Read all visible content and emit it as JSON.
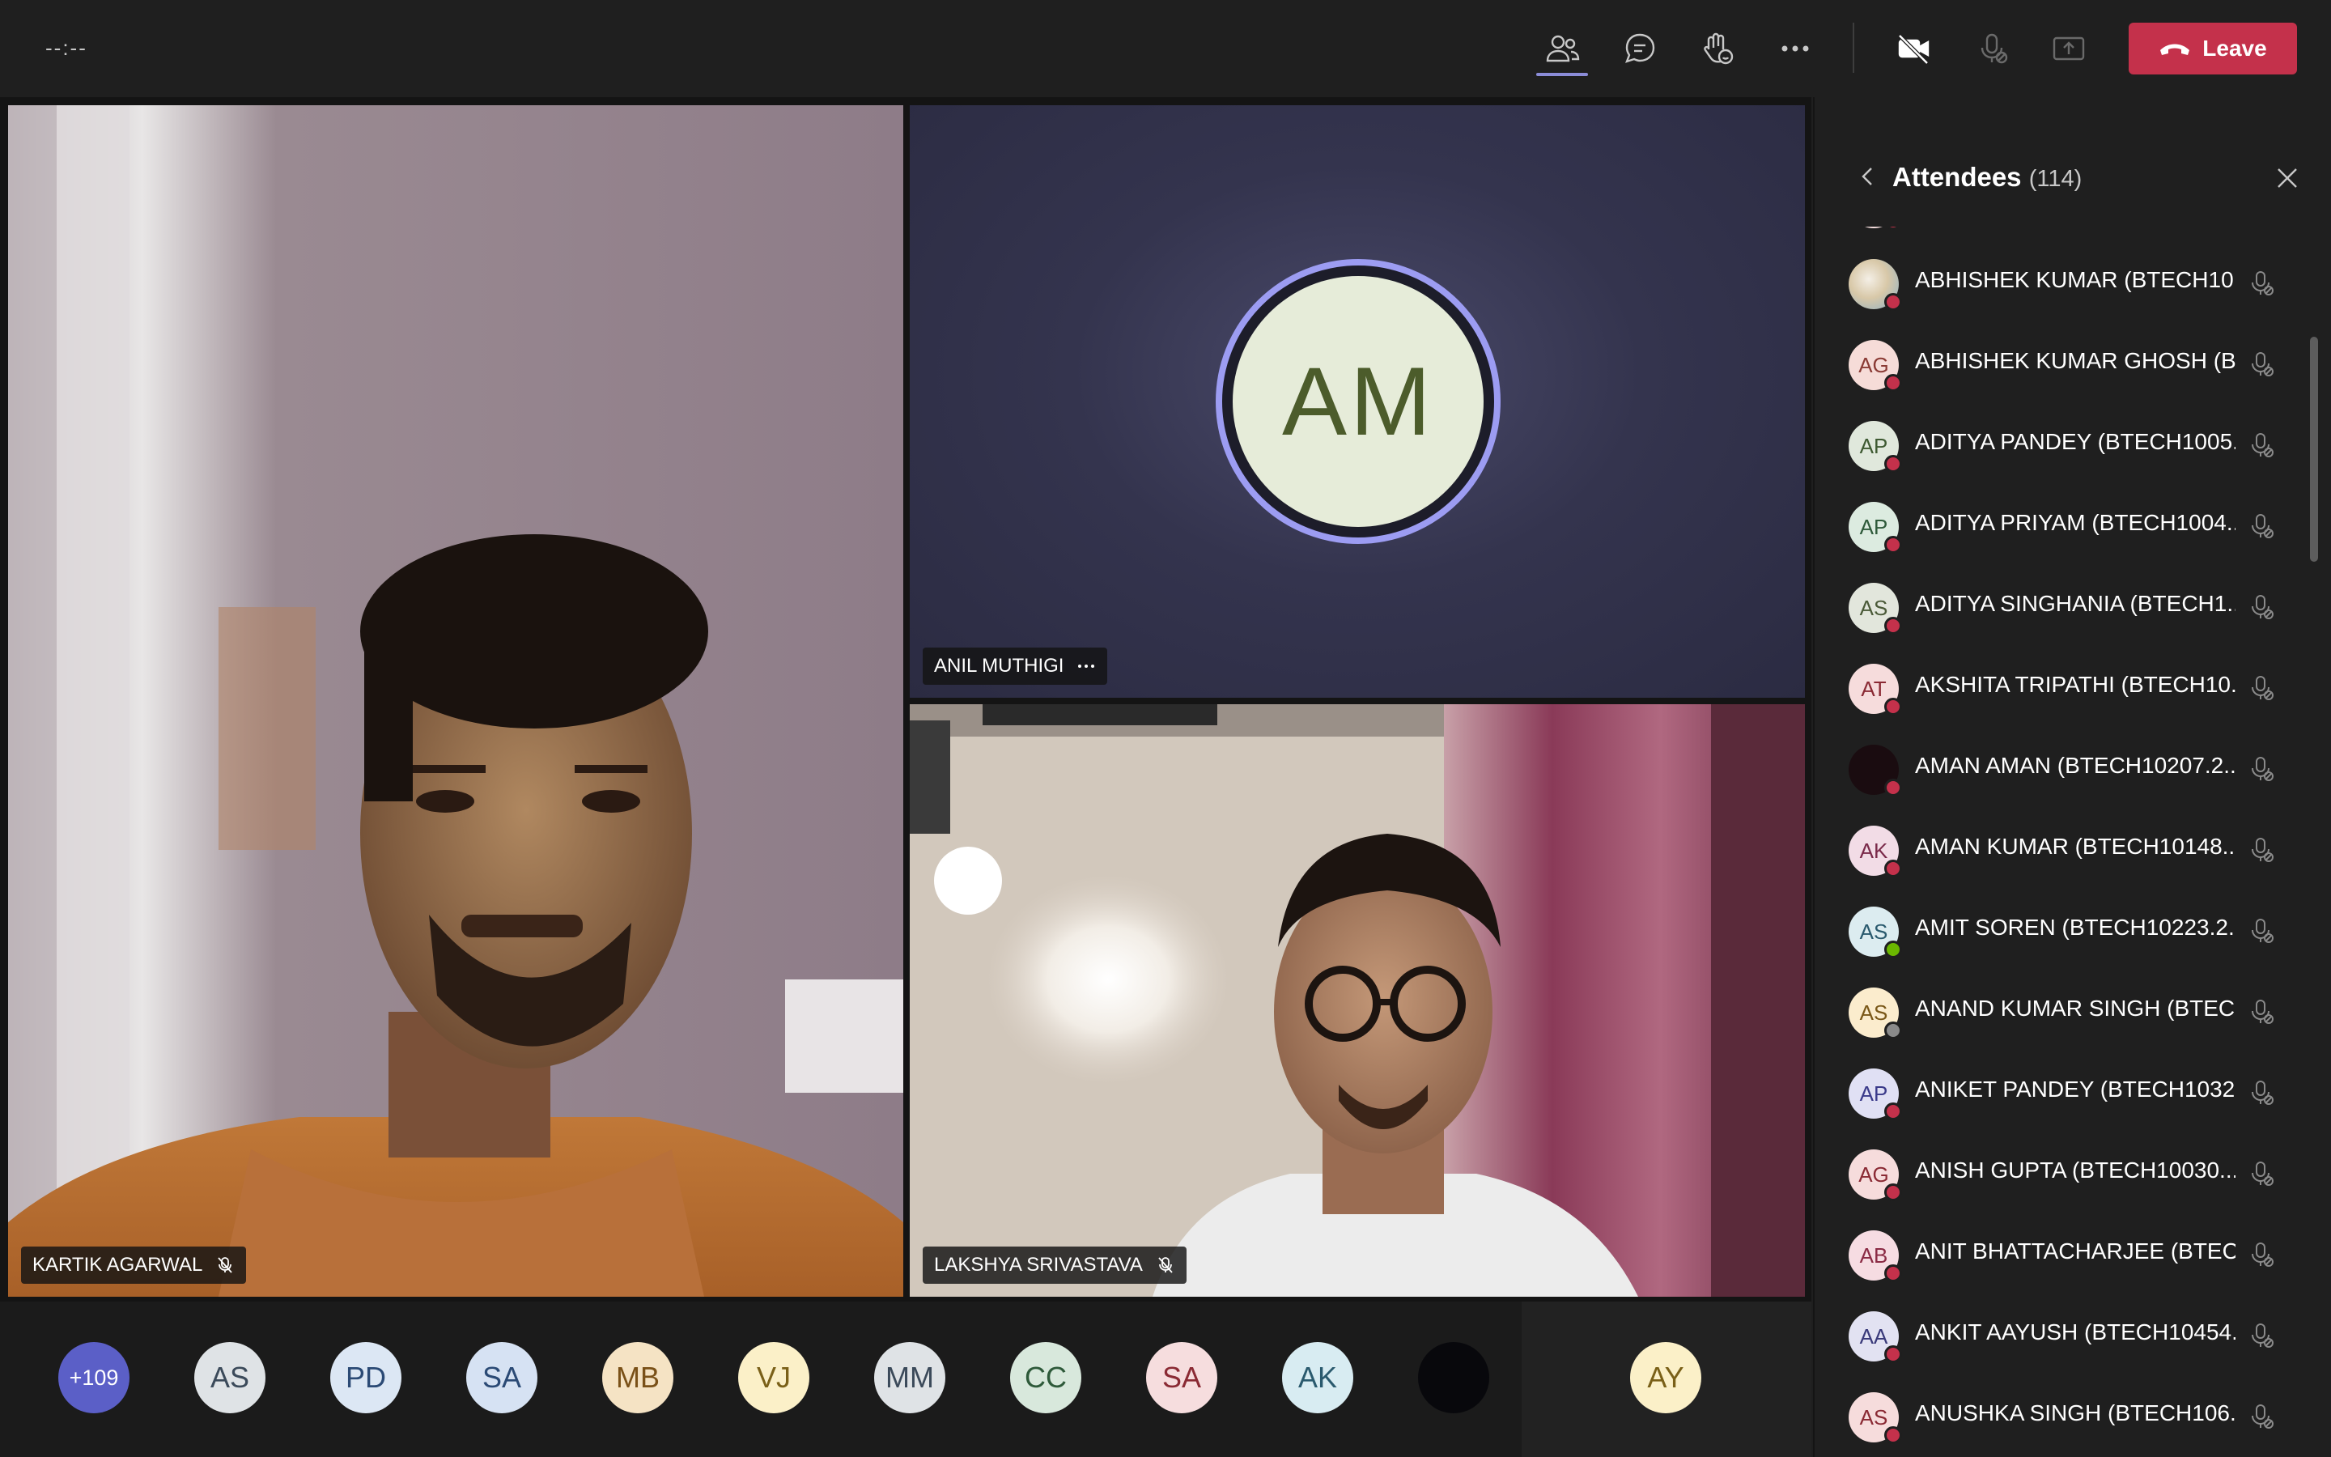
{
  "header": {
    "timer": "--:--",
    "leave_label": "Leave"
  },
  "toolbar": {
    "icons": [
      "people-icon",
      "chat-icon",
      "raise-hand-icon",
      "more-icon",
      "camera-off-icon",
      "mic-disabled-icon",
      "share-icon",
      "phone-hangup-icon"
    ]
  },
  "tiles": [
    {
      "name": "KARTIK AGARWAL",
      "muted": true
    },
    {
      "name": "ANIL MUTHIGI",
      "initials": "AM",
      "has_more": true
    },
    {
      "name": "LAKSHYA SRIVASTAVA",
      "muted": true
    }
  ],
  "strip": {
    "overflow_label": "+109",
    "avatars": [
      {
        "initials": "AS"
      },
      {
        "initials": "PD"
      },
      {
        "initials": "SA"
      },
      {
        "initials": "MB"
      },
      {
        "initials": "VJ"
      },
      {
        "initials": "MM"
      },
      {
        "initials": "CC"
      },
      {
        "initials": "SA"
      },
      {
        "initials": "AK"
      },
      {
        "initials": ""
      }
    ],
    "self_avatar": "AY"
  },
  "attendees": {
    "title": "Attendees",
    "count": "(114)",
    "items": [
      {
        "name": "ABHISHEK KUMAR (BTECH10...",
        "initials": "",
        "photo": true,
        "status": "busy"
      },
      {
        "name": "ABHISHEK KUMAR GHOSH (B...",
        "initials": "AG",
        "status": "busy"
      },
      {
        "name": "ADITYA PANDEY (BTECH1005...",
        "initials": "AP",
        "status": "busy"
      },
      {
        "name": "ADITYA PRIYAM (BTECH1004...",
        "initials": "AP",
        "status": "busy"
      },
      {
        "name": "ADITYA SINGHANIA (BTECH1...",
        "initials": "AS",
        "status": "busy"
      },
      {
        "name": "AKSHITA TRIPATHI (BTECH10...",
        "initials": "AT",
        "status": "busy"
      },
      {
        "name": "AMAN AMAN (BTECH10207.2...",
        "initials": "",
        "photo": true,
        "status": "busy"
      },
      {
        "name": "AMAN KUMAR (BTECH10148....",
        "initials": "AK",
        "status": "busy"
      },
      {
        "name": "AMIT SOREN (BTECH10223.2...",
        "initials": "AS",
        "status": "available"
      },
      {
        "name": "ANAND KUMAR SINGH (BTEC...",
        "initials": "AS",
        "status": "offline"
      },
      {
        "name": "ANIKET PANDEY (BTECH1032...",
        "initials": "AP",
        "status": "busy"
      },
      {
        "name": "ANISH GUPTA (BTECH10030....",
        "initials": "AG",
        "status": "busy"
      },
      {
        "name": "ANIT BHATTACHARJEE (BTEC...",
        "initials": "AB",
        "status": "busy"
      },
      {
        "name": "ANKIT AAYUSH (BTECH10454...",
        "initials": "AA",
        "status": "busy"
      },
      {
        "name": "ANUSHKA SINGH (BTECH106...",
        "initials": "AS",
        "status": "busy"
      }
    ]
  },
  "colors": {
    "accent": "#9c9cf2",
    "leave": "#c4314b",
    "busy": "#c4314b",
    "available": "#6bb700"
  }
}
